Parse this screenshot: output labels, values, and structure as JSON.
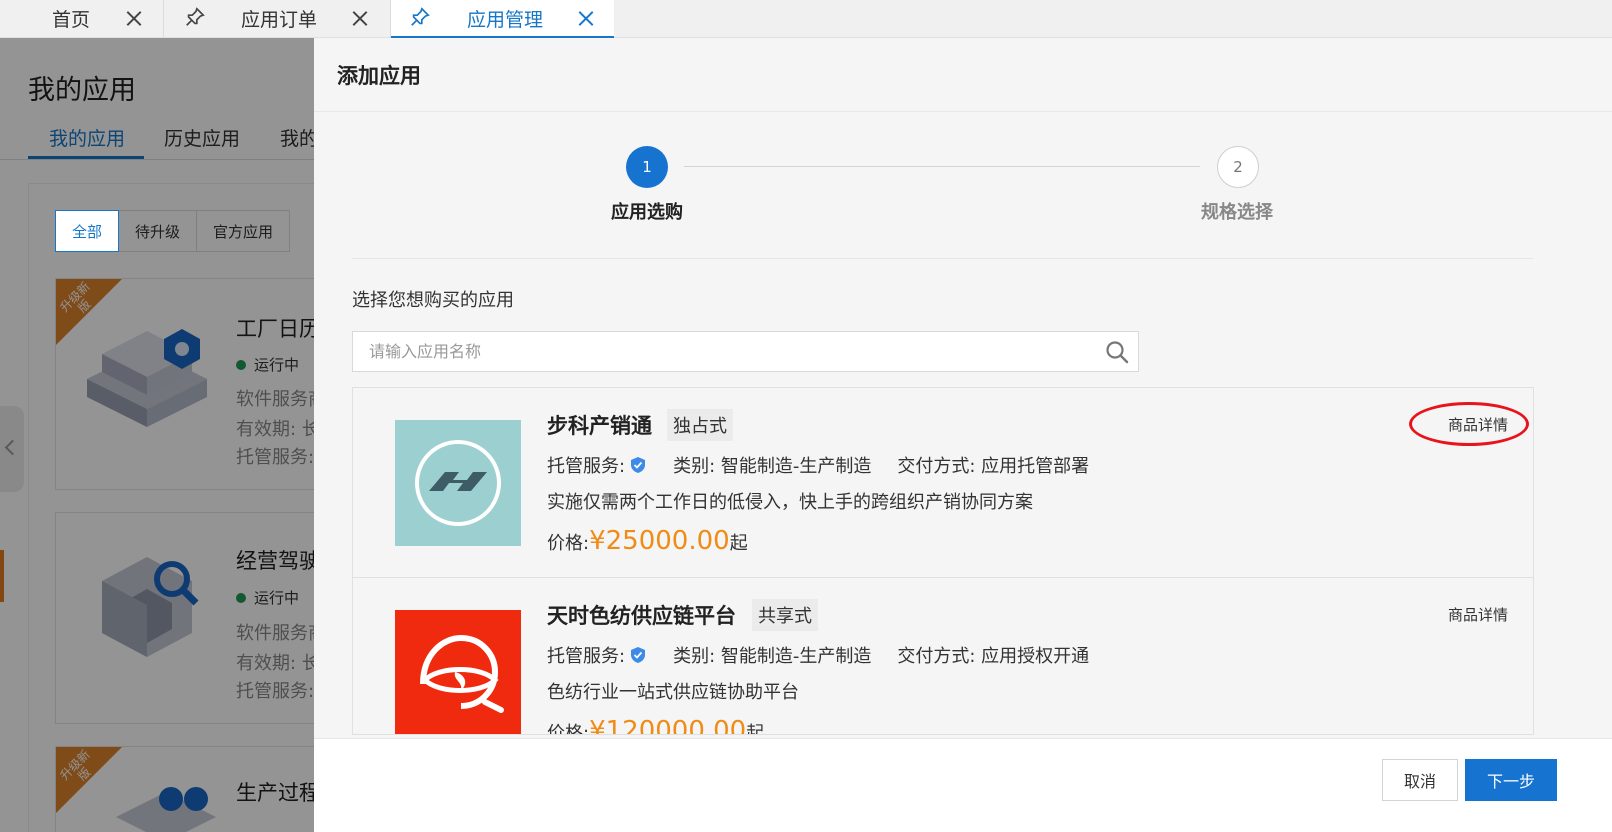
{
  "tabs": [
    {
      "label": "首页",
      "pinned": false,
      "active": false
    },
    {
      "label": "应用订单",
      "pinned": true,
      "active": false
    },
    {
      "label": "应用管理",
      "pinned": true,
      "active": true
    }
  ],
  "background_page": {
    "title": "我的应用",
    "tabs": [
      "我的应用",
      "历史应用",
      "我的"
    ],
    "filters": [
      "全部",
      "待升级",
      "官方应用"
    ],
    "ribbon_text": "升级新版",
    "cards": [
      {
        "title": "工厂日历",
        "status": "运行中",
        "lines": [
          "软件服务商:",
          "有效期: 长",
          "托管服务:"
        ]
      },
      {
        "title": "经营驾驶",
        "status": "运行中",
        "lines": [
          "软件服务商:",
          "有效期: 长",
          "托管服务:"
        ]
      },
      {
        "title": "生产过程",
        "status": "",
        "lines": []
      }
    ]
  },
  "drawer": {
    "title": "添加应用",
    "steps": [
      {
        "number": "1",
        "label": "应用选购",
        "state": "active"
      },
      {
        "number": "2",
        "label": "规格选择",
        "state": "pending"
      }
    ],
    "select_prompt": "选择您想购买的应用",
    "search": {
      "placeholder": "请输入应用名称"
    },
    "apps": [
      {
        "name": "步科产销通",
        "mode": "独占式",
        "hosting_label": "托管服务:",
        "category": "类别: 智能制造-生产制造",
        "delivery": "交付方式: 应用托管部署",
        "description": "实施仅需两个工作日的低侵入，快上手的跨组织产销协同方案",
        "price_label": "价格:",
        "price": "¥25000.00",
        "price_suffix": "起",
        "detail_link": "商品详情",
        "logo_color": "#9ccfd0"
      },
      {
        "name": "天时色纺供应链平台",
        "mode": "共享式",
        "hosting_label": "托管服务:",
        "category": "类别: 智能制造-生产制造",
        "delivery": "交付方式: 应用授权开通",
        "description": "色纺行业一站式供应链协助平台",
        "price_label": "价格:",
        "price": "¥120000.00",
        "price_suffix": "起",
        "detail_link": "商品详情",
        "logo_color": "#f02a0e"
      }
    ],
    "footer": {
      "cancel": "取消",
      "next": "下一步"
    }
  },
  "colors": {
    "primary": "#1673d0",
    "price": "#f08c16",
    "highlight_ring": "#e8141c"
  }
}
